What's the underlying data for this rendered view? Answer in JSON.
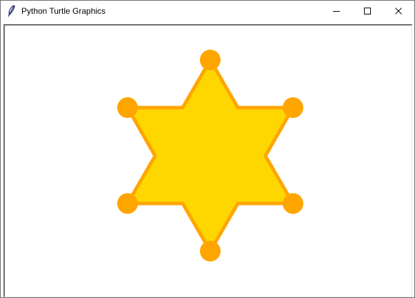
{
  "window": {
    "title": "Python Turtle Graphics",
    "icons": {
      "app": "feather-icon",
      "minimize": "minimize-icon",
      "maximize": "maximize-icon",
      "close": "close-icon"
    }
  },
  "canvas": {
    "shape": "six-pointed-star",
    "colors": {
      "star_fill": "#FFD700",
      "star_outline": "#FFA500",
      "tip_dots": "#FFA500",
      "background": "#FFFFFF"
    },
    "tip_dot_count": 6
  }
}
